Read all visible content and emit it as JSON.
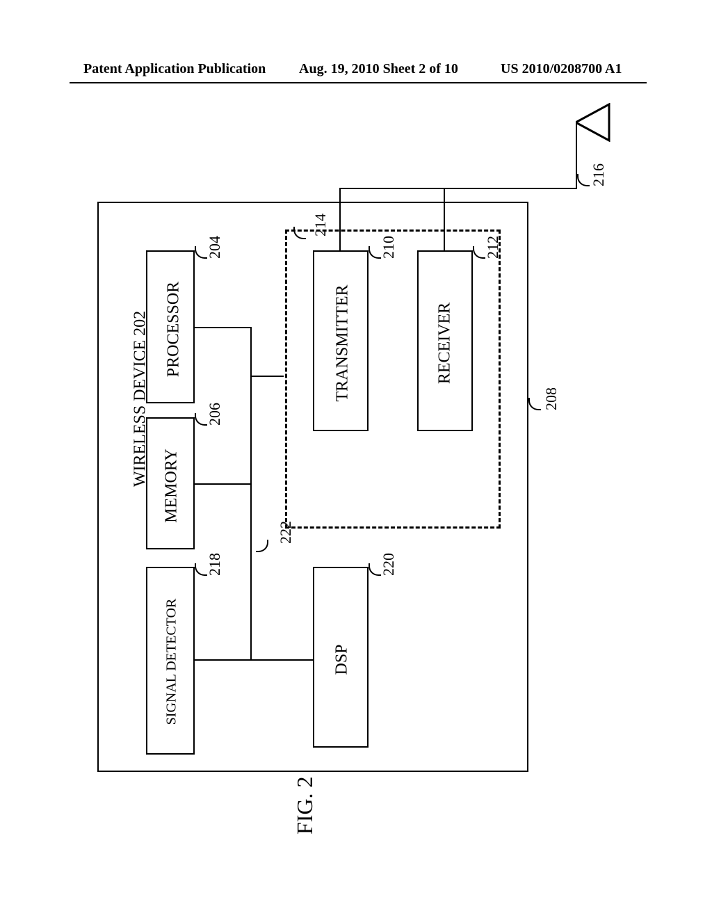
{
  "header": {
    "left": "Patent Application Publication",
    "center": "Aug. 19, 2010  Sheet 2 of 10",
    "right": "US 2010/0208700 A1"
  },
  "diagram": {
    "title": "WIRELESS DEVICE 202",
    "blocks": {
      "processor": "PROCESSOR",
      "memory": "MEMORY",
      "signal_detector": "SIGNAL DETECTOR",
      "transmitter": "TRANSMITTER",
      "receiver": "RECEIVER",
      "dsp": "DSP"
    },
    "refs": {
      "processor": "204",
      "memory": "206",
      "signal_detector": "218",
      "transmitter": "210",
      "receiver": "212",
      "transceiver": "214",
      "dsp": "220",
      "bus": "222",
      "housing": "208",
      "antenna": "216"
    },
    "figure_label": "FIG. 2"
  }
}
